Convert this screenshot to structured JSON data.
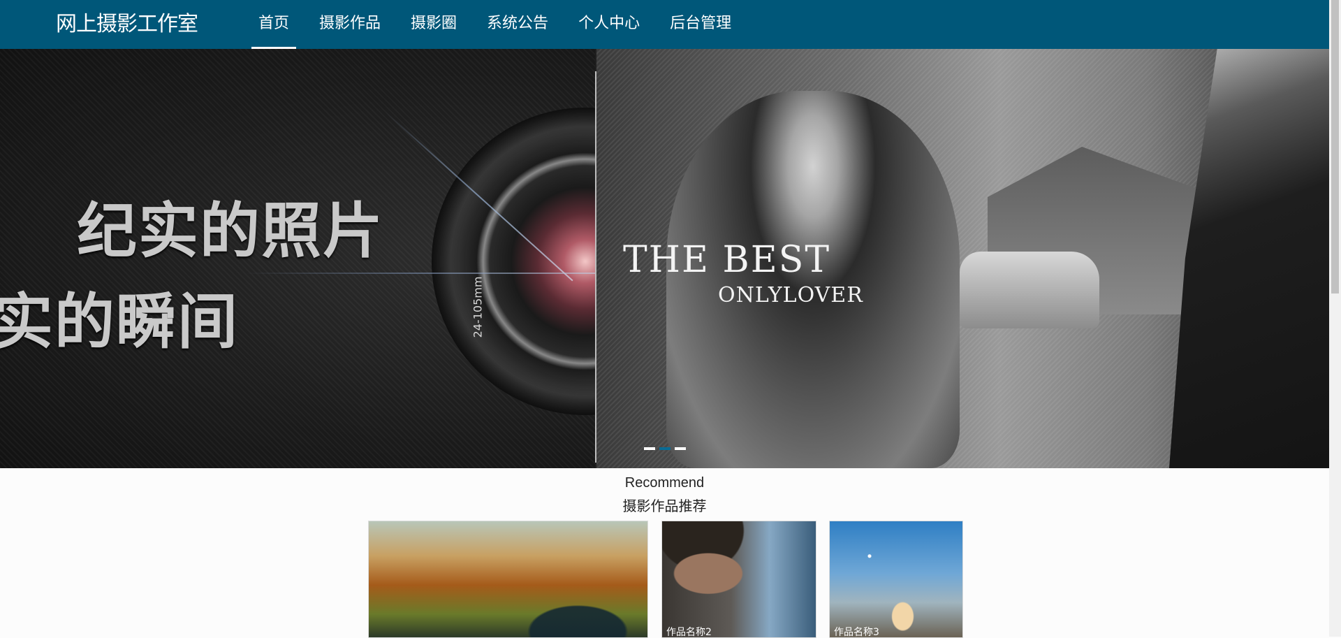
{
  "brand": "网上摄影工作室",
  "nav": [
    {
      "label": "首页",
      "active": true
    },
    {
      "label": "摄影作品",
      "active": false
    },
    {
      "label": "摄影圈",
      "active": false
    },
    {
      "label": "系统公告",
      "active": false
    },
    {
      "label": "个人中心",
      "active": false
    },
    {
      "label": "后台管理",
      "active": false
    }
  ],
  "banner": {
    "cn_line1": "纪实的照片",
    "cn_line2": "实的瞬间",
    "lens_text": "24-105mm",
    "best_line1": "THE BEST",
    "best_line2": "ONLYLOVER",
    "slides": 3,
    "active_slide": 2
  },
  "recommend": {
    "title_en": "Recommend",
    "title_cn": "摄影作品推荐",
    "items": [
      {
        "caption": ""
      },
      {
        "caption": "作品名称2"
      },
      {
        "caption": "作品名称3"
      }
    ]
  },
  "colors": {
    "navbar": "#005779",
    "dot_active": "#0a6b94"
  }
}
